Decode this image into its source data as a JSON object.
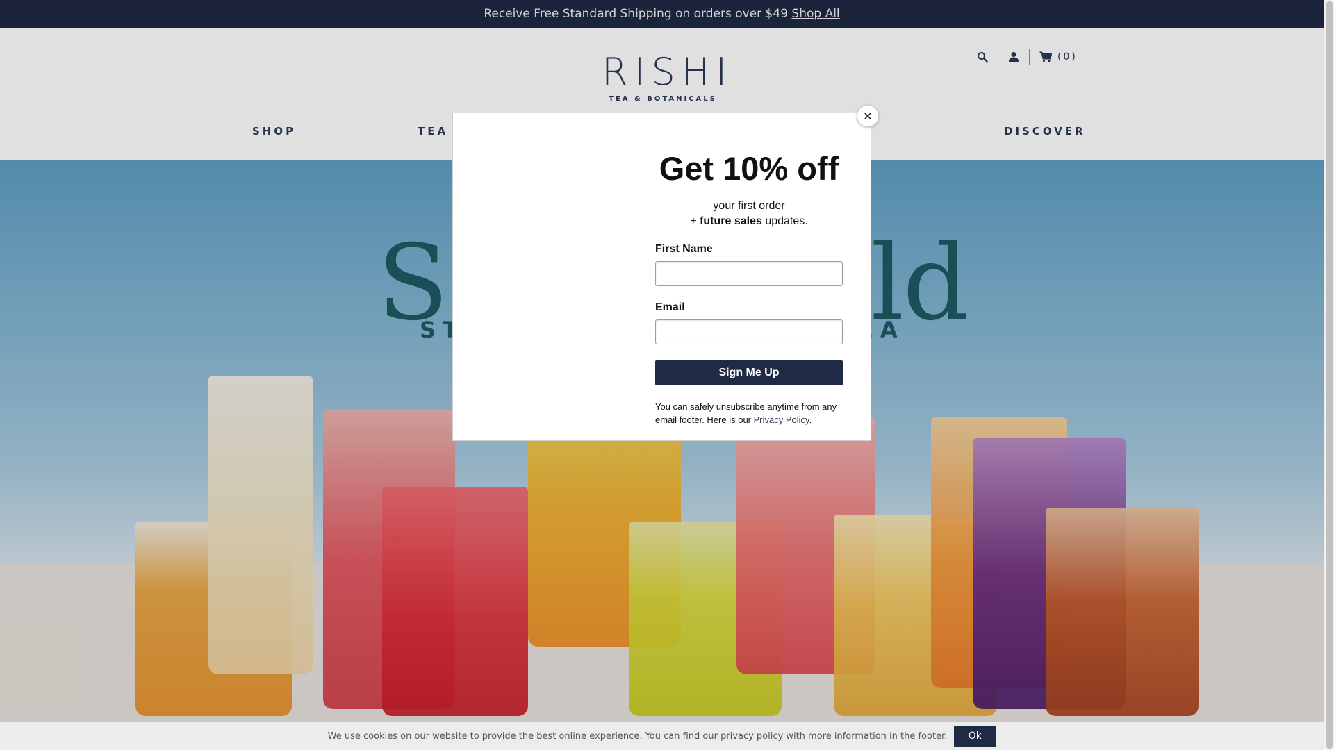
{
  "announcement": {
    "text": "Receive Free Standard Shipping on orders over $49 ",
    "link": "Shop All"
  },
  "header": {
    "logo_main": "RISHI",
    "logo_sub": "TEA & BOTANICALS",
    "cart_count": "(0)",
    "icons": [
      "search-icon",
      "account-icon",
      "cart-icon"
    ]
  },
  "nav": {
    "items": [
      "SHOP",
      "TEA",
      "DISCOVER"
    ]
  },
  "hero": {
    "title_left": "So",
    "title_right": "old",
    "sub_left": "STA",
    "sub_right": "EA"
  },
  "popup": {
    "title": "Get 10% off",
    "line1": "your first order",
    "line2_prefix": "+ ",
    "line2_bold": "future sales",
    "line2_suffix": " updates.",
    "first_name_label": "First Name",
    "first_name_value": "",
    "email_label": "Email",
    "email_value": "",
    "submit_label": "Sign Me Up",
    "note_text": "You can safely unsubscribe anytime from any email footer. Here is our ",
    "note_link": "Privacy Policy",
    "note_end": ".",
    "close_label": "✕"
  },
  "cookie": {
    "text": "We use cookies on our website to provide the best online experience.  You can find our privacy policy with more information in the footer.",
    "button": "Ok"
  },
  "colors": {
    "navy": "#1f2a44",
    "hero_text": "#1d5b62"
  }
}
